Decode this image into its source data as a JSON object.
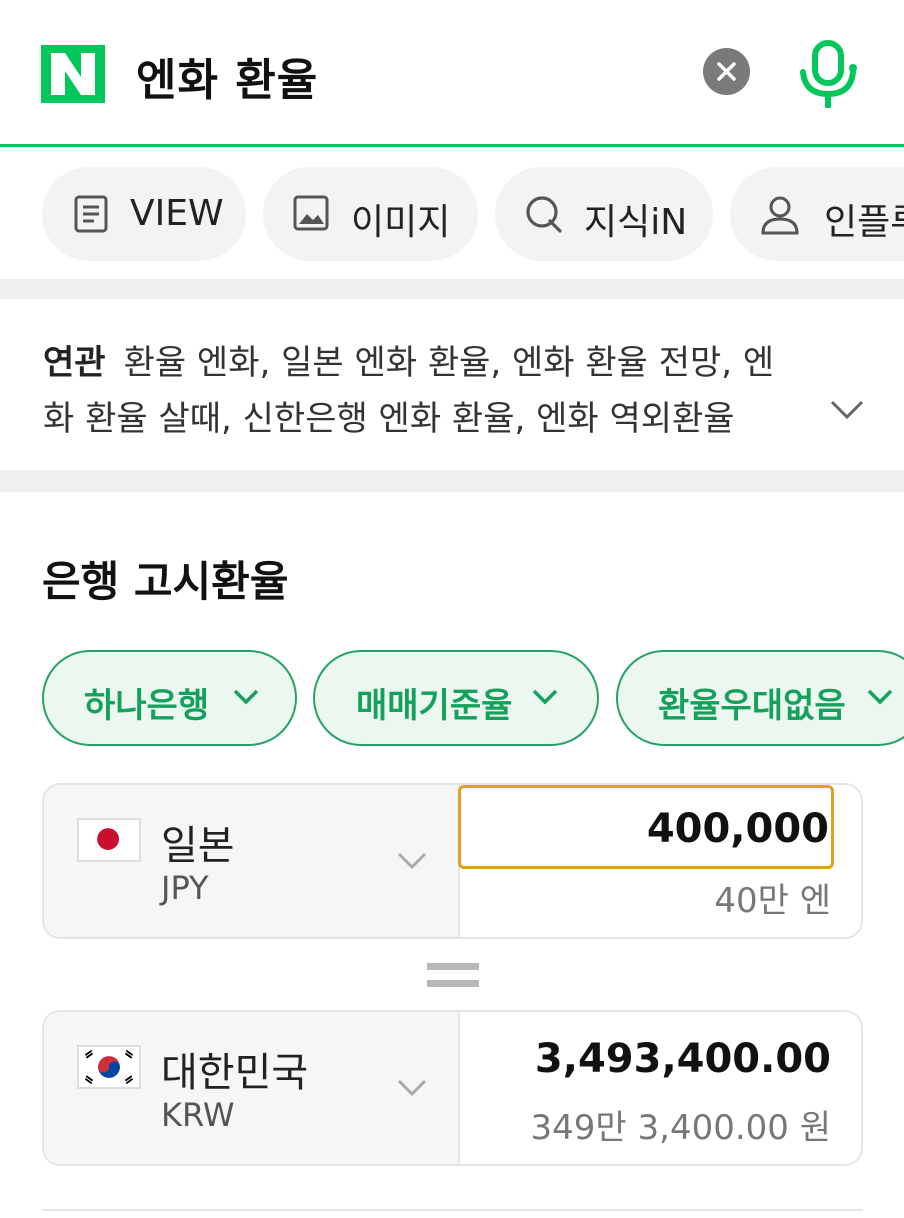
{
  "search": {
    "query": "엔화 환율",
    "brand_color": "#03c75a"
  },
  "tabs": [
    {
      "label": "VIEW",
      "icon": "document-icon"
    },
    {
      "label": "이미지",
      "icon": "image-icon"
    },
    {
      "label": "지식iN",
      "icon": "q-icon"
    },
    {
      "label": "인플루",
      "icon": "person-icon"
    }
  ],
  "related": {
    "heading": "연관",
    "line1": "환율 엔화, 일본 엔화 환율, 엔화 환율 전망, 엔",
    "line2": "화 환율 살때, 신한은행 엔화 환율, 엔화 역외환율"
  },
  "section": {
    "title": "은행 고시환율"
  },
  "filters": [
    {
      "label": "하나은행"
    },
    {
      "label": "매매기준율"
    },
    {
      "label": "환율우대없음"
    }
  ],
  "converter": {
    "from": {
      "name": "일본",
      "code": "JPY",
      "amount": "400,000",
      "amount_words": "40만 엔"
    },
    "to": {
      "name": "대한민국",
      "code": "KRW",
      "amount": "3,493,400.00",
      "amount_words": "349만 3,400.00 원"
    }
  }
}
